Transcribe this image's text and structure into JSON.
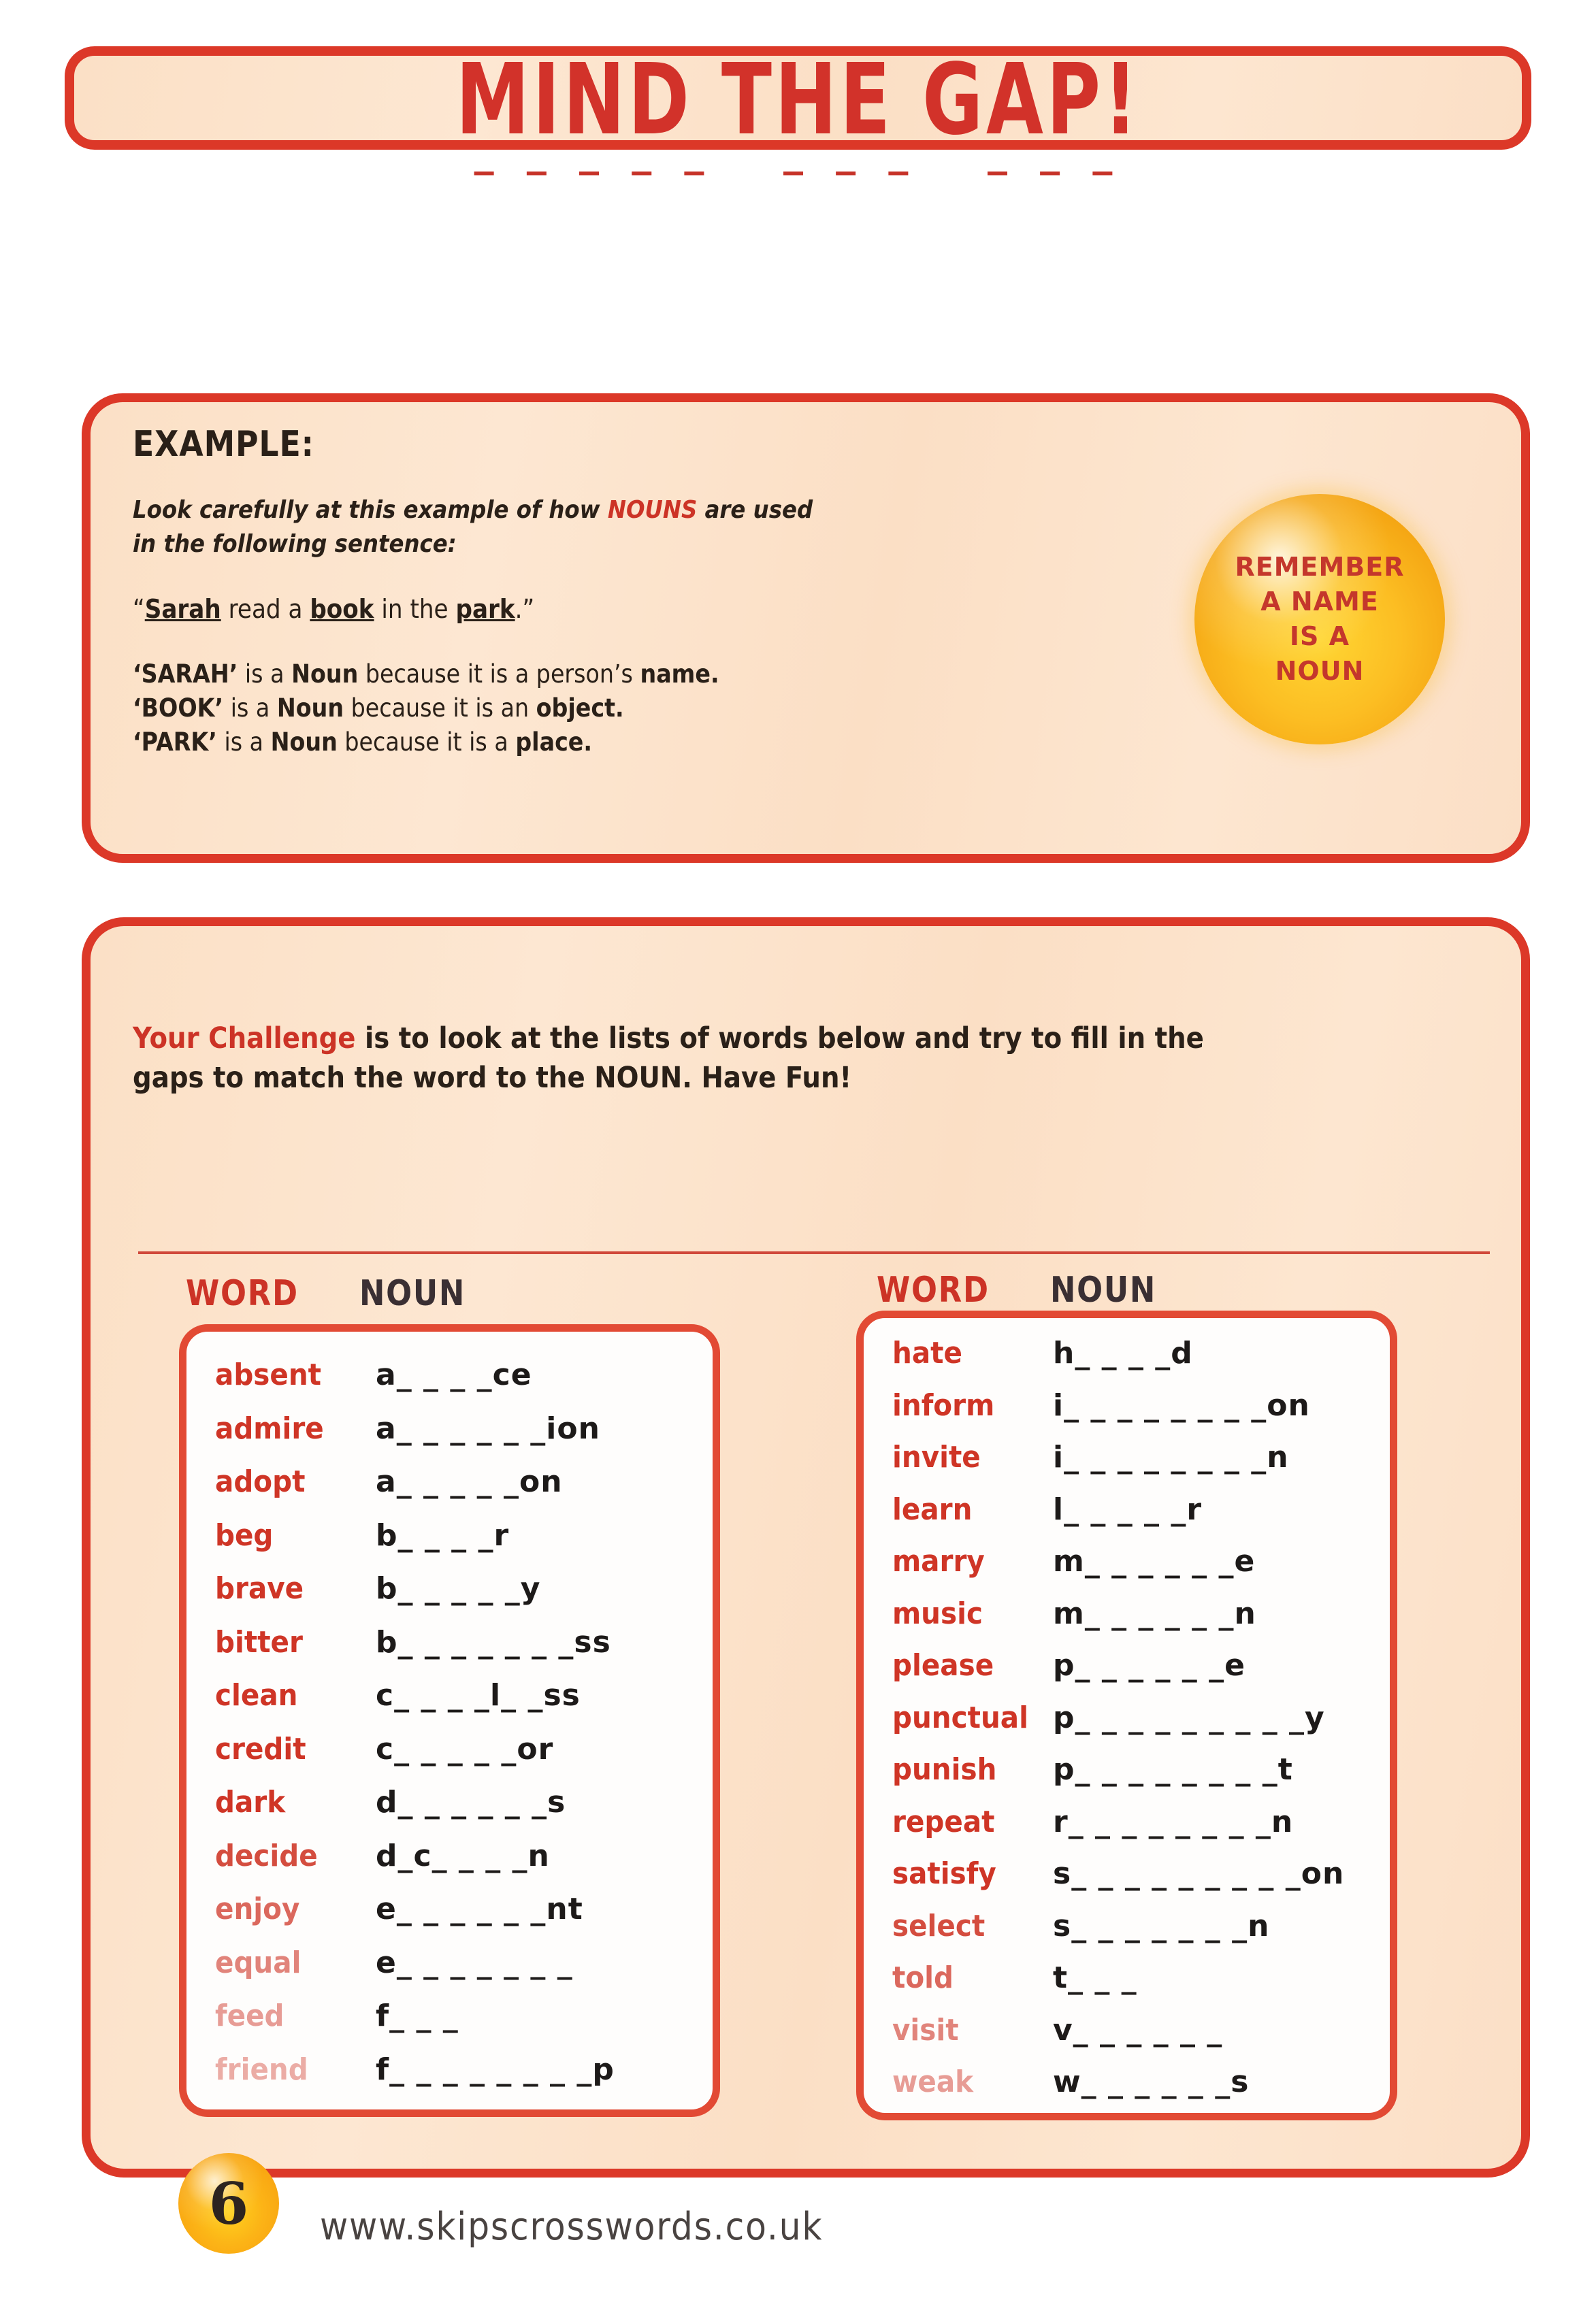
{
  "title": {
    "text": "MIND THE GAP!",
    "dashes": "_ _ _ _ _   _ _ _   _ _ _"
  },
  "example": {
    "heading": "EXAMPLE:",
    "intro_line1_before": "Look carefully at this example of how ",
    "intro_line1_accent": "NOUNS",
    "intro_line1_after": " are used",
    "intro_line2": "in the following sentence:",
    "sentence": "“Sarah read a book in the park.”",
    "reason1": "‘SARAH’ is a Noun because it is a person’s name.",
    "reason2": "‘BOOK’ is a Noun because it is an object.",
    "reason3": "‘PARK’ is a Noun because it is a place."
  },
  "badge": {
    "line1": "REMEMBER",
    "line2": "A NAME",
    "line3": "IS A",
    "line4": "NOUN",
    "color": "#f5a714",
    "text_color": "#c4372c"
  },
  "challenge": {
    "accent": "Your Challenge",
    "line1_rest": " is to look at the lists of words below and try to fill in the",
    "line2": "gaps to match the word to the NOUN. Have Fun!"
  },
  "columns": {
    "header_word": "WORD",
    "header_noun": "NOUN"
  },
  "left_list": [
    {
      "word": "absent",
      "pattern": "a_ _ _ _ce"
    },
    {
      "word": "admire",
      "pattern": "a_ _ _ _ _ _ion"
    },
    {
      "word": "adopt",
      "pattern": "a_ _ _ _ _on"
    },
    {
      "word": "beg",
      "pattern": "b_ _ _ _r"
    },
    {
      "word": "brave",
      "pattern": "b_ _ _ _ _y"
    },
    {
      "word": "bitter",
      "pattern": "b_ _ _ _ _ _ _ss"
    },
    {
      "word": "clean",
      "pattern": "c_ _ _ _l_ _ss"
    },
    {
      "word": "credit",
      "pattern": "c_ _ _ _ _or"
    },
    {
      "word": "dark",
      "pattern": "d_ _ _ _ _ _s"
    },
    {
      "word": "decide",
      "pattern": "d_c_ _ _ _n"
    },
    {
      "word": "enjoy",
      "pattern": "e_ _ _ _ _ _nt"
    },
    {
      "word": "equal",
      "pattern": "e_ _ _ _ _ _ _"
    },
    {
      "word": "feed",
      "pattern": "f_ _ _"
    },
    {
      "word": "friend",
      "pattern": "f_ _ _ _ _ _ _ _p"
    }
  ],
  "right_list": [
    {
      "word": "hate",
      "pattern": "h_ _ _ _d"
    },
    {
      "word": "inform",
      "pattern": "i_ _ _ _ _ _ _ _on"
    },
    {
      "word": "invite",
      "pattern": "i_ _ _ _ _ _ _ _n"
    },
    {
      "word": "learn",
      "pattern": "l_ _ _ _ _r"
    },
    {
      "word": "marry",
      "pattern": "m_ _ _ _ _ _e"
    },
    {
      "word": "music",
      "pattern": "m_ _ _ _ _ _n"
    },
    {
      "word": "please",
      "pattern": "p_ _ _ _ _ _e"
    },
    {
      "word": "punctual",
      "pattern": "p_ _ _ _ _ _ _ _ _y"
    },
    {
      "word": "punish",
      "pattern": "p_ _ _ _ _ _ _ _t"
    },
    {
      "word": "repeat",
      "pattern": "r_ _ _ _ _ _ _ _n"
    },
    {
      "word": "satisfy",
      "pattern": "s_ _ _ _ _ _ _ _ _on"
    },
    {
      "word": "select",
      "pattern": "s_ _ _ _ _ _ _n"
    },
    {
      "word": "told",
      "pattern": "t_ _ _"
    },
    {
      "word": "visit",
      "pattern": "v_ _ _ _ _ _"
    },
    {
      "word": "weak",
      "pattern": "w_ _ _ _ _ _s"
    }
  ],
  "footer": {
    "page_number": "6",
    "url": "www.skipscrosswords.co.uk"
  },
  "colors": {
    "red_border": "#dc3828",
    "panel_bg": "#fce3ca",
    "word_red": "#cf3526",
    "ink": "#1d1a19"
  }
}
